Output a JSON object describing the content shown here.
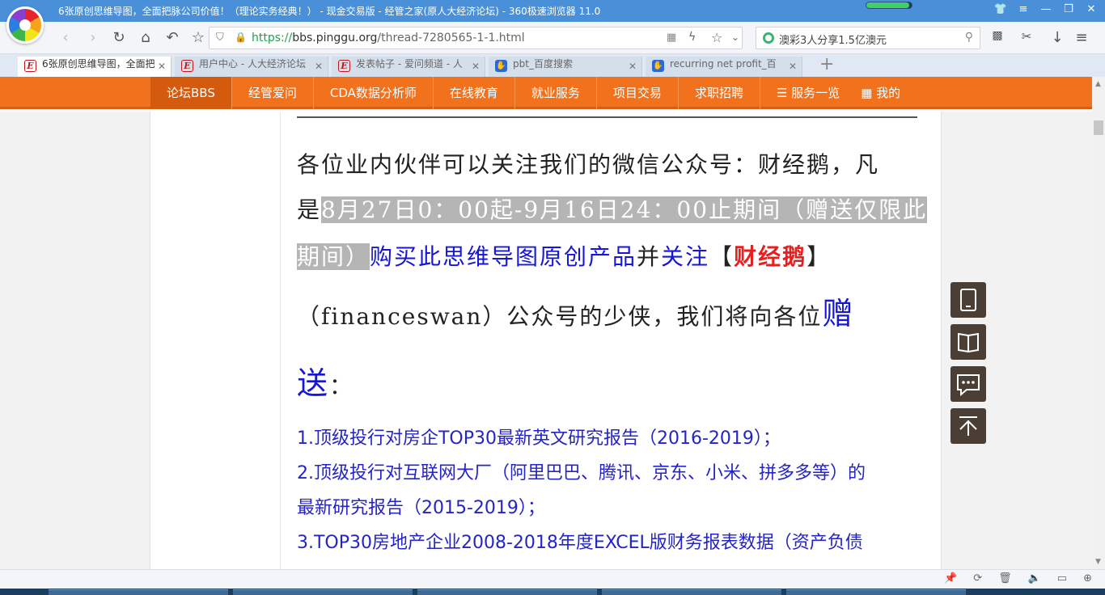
{
  "window": {
    "title": "6张原创思维导图，全面把脉公司价值！（理论实务经典！） - 现金交易版 - 经管之家(原人大经济论坛) - 360极速浏览器 11.0",
    "loading_progress": 0.95
  },
  "address": {
    "protocol": "https://",
    "host": "bbs.pinggu.org",
    "path": "/thread-7280565-1-1.html"
  },
  "search": {
    "value": "澳彩3人分享1.5亿澳元"
  },
  "tabs": [
    {
      "label": "6张原创思维导图，全面把",
      "icon": "E",
      "active": true
    },
    {
      "label": "用户中心 - 人大经济论坛",
      "icon": "E",
      "active": false
    },
    {
      "label": "发表帖子 - 爱问频道 - 人",
      "icon": "E",
      "active": false
    },
    {
      "label": "pbt_百度搜索",
      "icon": "paw",
      "active": false
    },
    {
      "label": "recurring net profit_百",
      "icon": "paw",
      "active": false
    }
  ],
  "site_nav": [
    "论坛BBS",
    "经管爱问",
    "CDA数据分析师",
    "在线教育",
    "就业服务",
    "项目交易",
    "求职招聘",
    "服务一览",
    "我的"
  ],
  "article": {
    "line1": "各位业内伙伴可以关注我们的微信公众号：财经鹅，凡",
    "line2_pre": "是",
    "line2_hl": "8月27日0：00起-9月16日24：00止期间（赠送仅限此",
    "line3_hl": "期间）",
    "line3_blue": "购买此思维导图原创产品",
    "line3_mid": "并",
    "line3_blue2": "关注",
    "line3_br_open": "【",
    "line3_red": "财经鹅",
    "line3_br_close": "】",
    "line4_pre": "（financeswan）公众号的少侠，我们将向各位",
    "line4_big": "赠",
    "line5_big": "送",
    "line5_colon": "：",
    "list": [
      "1.顶级投行对房企TOP30最新英文研究报告（2016-2019）；",
      "2.顶级投行对互联网大厂（阿里巴巴、腾讯、京东、小米、拼多多等）的",
      "最新研究报告（2015-2019）；",
      "3.TOP30房地产企业2008-2018年度EXCEL版财务报表数据（资产负债"
    ]
  },
  "float_buttons": [
    "tablet-icon",
    "book-icon",
    "chat-icon",
    "back-to-top-icon"
  ],
  "colors": {
    "titlebar": "#4a90d9",
    "orange_nav": "#f1711c",
    "link_blue": "#1616d6",
    "accent_red": "#e81f1f"
  }
}
